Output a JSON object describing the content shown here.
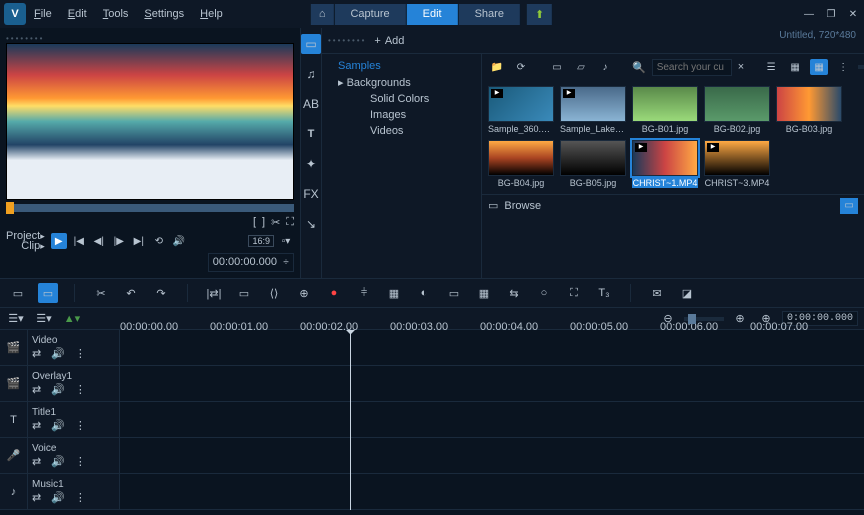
{
  "menu": {
    "file": "File",
    "edit": "Edit",
    "tools": "Tools",
    "settings": "Settings",
    "help": "Help"
  },
  "modes": {
    "capture": "Capture",
    "edit": "Edit",
    "share": "Share"
  },
  "project": {
    "title": "Untitled, 720*480"
  },
  "preview": {
    "label1": "Project",
    "label2": "Clip",
    "timecode": "00:00:00.000",
    "aspect": "16:9"
  },
  "library": {
    "add": "Add",
    "tree": {
      "samples": "Samples",
      "backgrounds": "Backgrounds",
      "solid": "Solid Colors",
      "images": "Images",
      "videos": "Videos"
    },
    "search_ph": "Search your cu",
    "items": [
      {
        "name": "Sample_360.mp4",
        "video": true
      },
      {
        "name": "Sample_Lake.m...",
        "video": true
      },
      {
        "name": "BG-B01.jpg",
        "video": false
      },
      {
        "name": "BG-B02.jpg",
        "video": false
      },
      {
        "name": "BG-B03.jpg",
        "video": false
      },
      {
        "name": "BG-B04.jpg",
        "video": false
      },
      {
        "name": "BG-B05.jpg",
        "video": false
      },
      {
        "name": "CHRIST~1.MP4",
        "video": true,
        "sel": true
      },
      {
        "name": "CHRIST~3.MP4",
        "video": true
      }
    ],
    "browse": "Browse"
  },
  "timeline": {
    "zoom_tc": "0:00:00.000",
    "marks": [
      "00:00:00.00",
      "00:00:01.00",
      "00:00:02.00",
      "00:00:03.00",
      "00:00:04.00",
      "00:00:05.00",
      "00:00:06.00",
      "00:00:07.00"
    ],
    "tracks": [
      {
        "name": "Video",
        "icon": "🎬"
      },
      {
        "name": "Overlay1",
        "icon": "🎬"
      },
      {
        "name": "Title1",
        "icon": "T"
      },
      {
        "name": "Voice",
        "icon": "🎤"
      },
      {
        "name": "Music1",
        "icon": "♪"
      }
    ]
  }
}
